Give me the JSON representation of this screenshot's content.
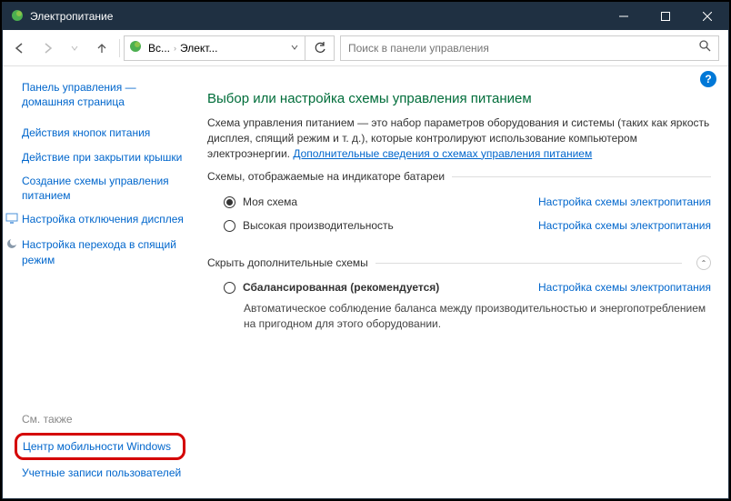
{
  "window": {
    "title": "Электропитание"
  },
  "breadcrumb": {
    "seg1": "Вс...",
    "seg2": "Элект..."
  },
  "search": {
    "placeholder": "Поиск в панели управления"
  },
  "sidebar": {
    "home": "Панель управления — домашняя страница",
    "buttons": "Действия кнопок питания",
    "lid": "Действие при закрытии крышки",
    "createplan": "Создание схемы управления питанием",
    "display": "Настройка отключения дисплея",
    "sleep": "Настройка перехода в спящий режим",
    "seealso": "См. также",
    "mobility": "Центр мобильности Windows",
    "accounts": "Учетные записи пользователей"
  },
  "content": {
    "heading": "Выбор или настройка схемы управления питанием",
    "desc1": "Схема управления питанием — это набор параметров оборудования и системы (таких как яркость дисплея, спящий режим и т. д.), которые контролируют использование компьютером электроэнергии. ",
    "learnmore": "Дополнительные сведения о схемах управления питанием",
    "group_indicator": "Схемы, отображаемые на индикаторе батареи",
    "plan_my": "Моя схема",
    "plan_highperf": "Высокая производительность",
    "configure": "Настройка схемы электропитания",
    "hide_more": "Скрыть дополнительные схемы",
    "plan_balanced": "Сбалансированная (рекомендуется)",
    "balanced_desc": "Автоматическое соблюдение баланса между производительностью и энергопотреблением на пригодном для этого оборудовании."
  }
}
